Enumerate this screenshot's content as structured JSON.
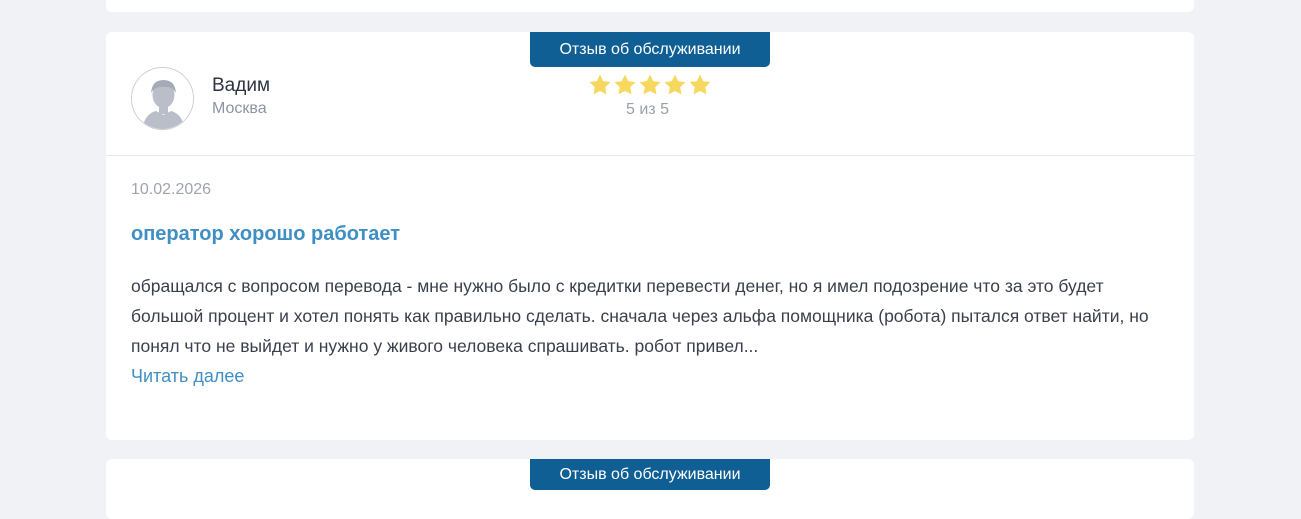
{
  "review": {
    "badge": "Отзыв об обслуживании",
    "author": {
      "name": "Вадим",
      "city": "Москва"
    },
    "rating": {
      "value": 5,
      "max": 5,
      "text": "5 из 5",
      "star_color": "#f7d85f"
    },
    "date": "10.02.2026",
    "title": "оператор хорошо работает",
    "text": "обращался с вопросом перевода - мне нужно было с кредитки перевести денег, но я имел подозрение что за это будет большой процент и хотел понять как правильно сделать. сначала через альфа помощника (робота) пытался ответ найти, но понял что не выйдет и нужно у живого человека спрашивать. робот привел...",
    "read_more": "Читать далее"
  },
  "next_review": {
    "badge": "Отзыв об обслуживании"
  },
  "colors": {
    "badge_bg": "#0f5f95",
    "link": "#3f8fc4",
    "page_bg": "#f0f2f5"
  }
}
